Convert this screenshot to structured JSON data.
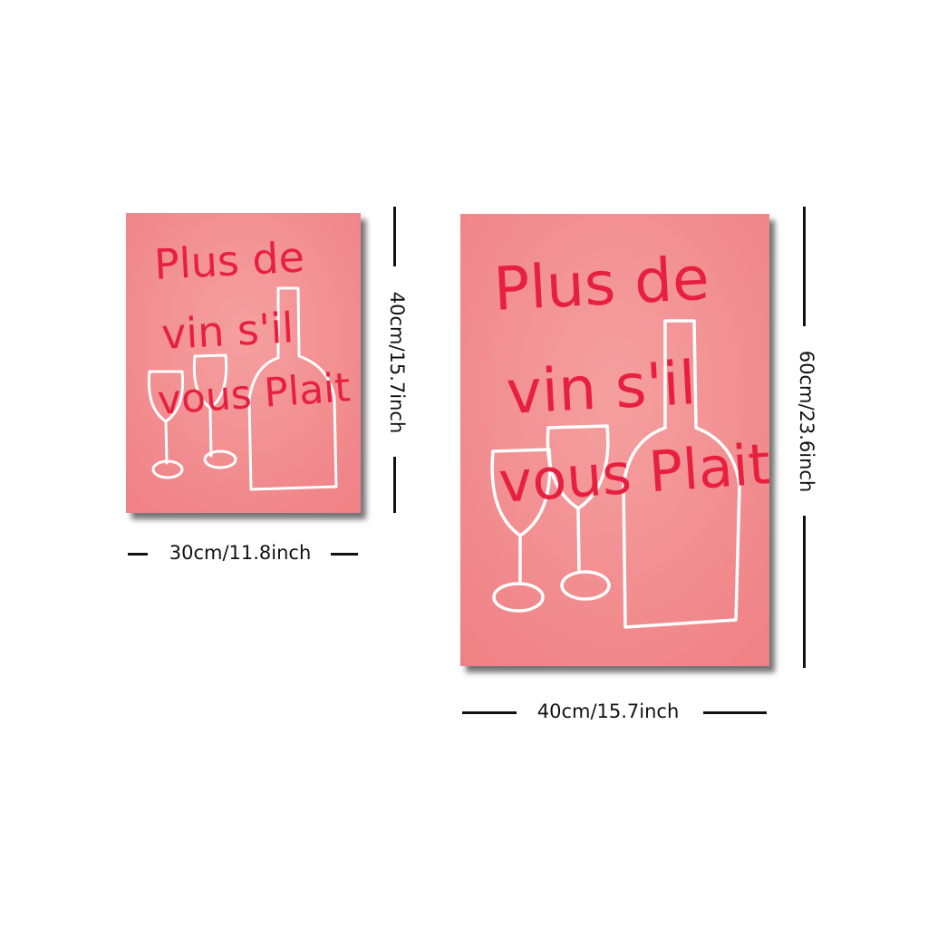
{
  "posters": {
    "small": {
      "text_lines": [
        "Plus de",
        "vin s'il",
        "vous Plait"
      ],
      "width_label": "30cm/11.8inch",
      "height_label": "40cm/15.7inch"
    },
    "large": {
      "text_lines": [
        "Plus de",
        "vin s'il",
        "vous Plait"
      ],
      "width_label": "40cm/15.7inch",
      "height_label": "60cm/23.6inch"
    }
  },
  "colors": {
    "poster_background": "#f28a8c",
    "lettering": "#e8203f",
    "drawing": "#ffffff",
    "page_background": "#ffffff"
  }
}
